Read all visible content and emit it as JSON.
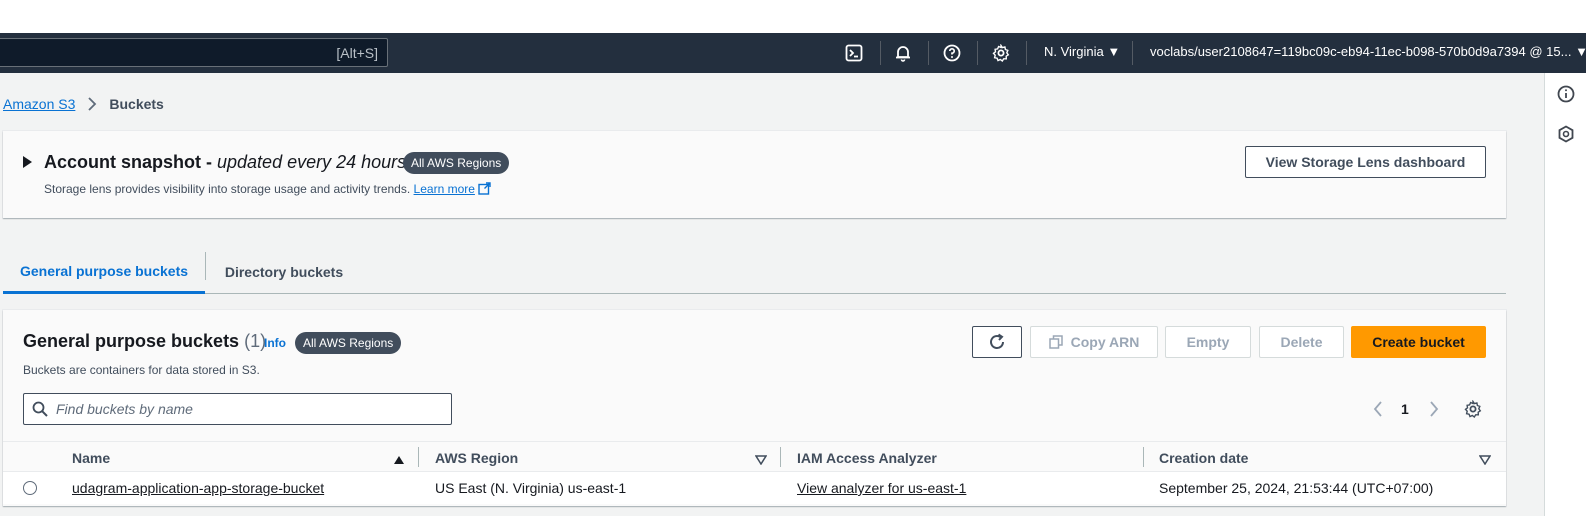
{
  "nav": {
    "search_shortcut": "[Alt+S]",
    "region": "N. Virginia ▼",
    "account": "voclabs/user2108647=119bc09c-eb94-11ec-b098-570b0d9a7394 @ 15... ▼"
  },
  "breadcrumb": {
    "root": "Amazon S3",
    "current": "Buckets"
  },
  "snapshot": {
    "title": "Account snapshot",
    "dash": " - ",
    "subtitle": "updated every 24 hours",
    "badge": "All AWS Regions",
    "description": "Storage lens provides visibility into storage usage and activity trends.",
    "learn_more": "Learn more",
    "dashboard_button": "View Storage Lens dashboard"
  },
  "tabs": [
    {
      "label": "General purpose buckets",
      "active": true
    },
    {
      "label": "Directory buckets",
      "active": false
    }
  ],
  "buckets": {
    "title": "General purpose buckets",
    "count": "(1)",
    "info": "Info",
    "badge": "All AWS Regions",
    "description": "Buckets are containers for data stored in S3.",
    "search_placeholder": "Find buckets by name",
    "buttons": {
      "copy_arn": "Copy ARN",
      "empty": "Empty",
      "delete": "Delete",
      "create": "Create bucket"
    },
    "page": "1",
    "columns": [
      "Name",
      "AWS Region",
      "IAM Access Analyzer",
      "Creation date"
    ],
    "rows": [
      {
        "name": "udagram-application-app-storage-bucket",
        "region": "US East (N. Virginia) us-east-1",
        "analyzer": "View analyzer for us-east-1",
        "created": "September 25, 2024, 21:53:44 (UTC+07:00)"
      }
    ]
  },
  "colors": {
    "nav_bg": "#232f3e",
    "link": "#0972d3",
    "primary_button": "#ff9900",
    "badge_bg": "#414d5c"
  },
  "icons": [
    "cloudshell-icon",
    "bell-icon",
    "help-icon",
    "settings-icon",
    "refresh-icon",
    "copy-icon",
    "external-link-icon",
    "search-icon",
    "chevron-left-icon",
    "chevron-right-icon",
    "gear-icon",
    "sort-ascending-icon",
    "sort-icon"
  ]
}
